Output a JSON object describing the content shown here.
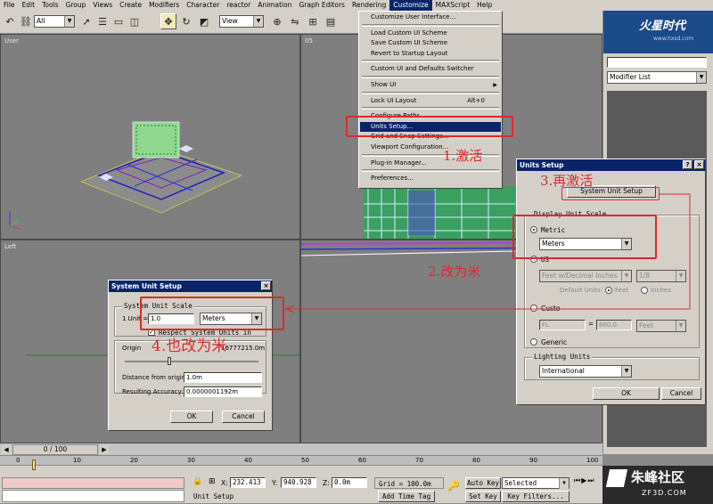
{
  "menubar": [
    "File",
    "Edit",
    "Tools",
    "Group",
    "Views",
    "Create",
    "Modifiers",
    "Character",
    "reactor",
    "Animation",
    "Graph Editors",
    "Rendering",
    "Customize",
    "MAXScript",
    "Help"
  ],
  "toolbar": {
    "selection_filter": "All",
    "coord_system": "View"
  },
  "watermark_top": "火星时代",
  "watermark_top_url": "www.hxsd.com",
  "viewports": {
    "top_left": "User",
    "top_right": "05",
    "bottom_left": "Left"
  },
  "customize_menu": {
    "items": [
      {
        "label": "Customize User Interface..."
      },
      {
        "sep": true
      },
      {
        "label": "Load Custom UI Scheme"
      },
      {
        "label": "Save Custom UI Scheme"
      },
      {
        "label": "Revert to Startup Layout"
      },
      {
        "sep": true
      },
      {
        "label": "Custom UI and Defaults Switcher"
      },
      {
        "sep": true
      },
      {
        "label": "Show UI",
        "submenu": true
      },
      {
        "sep": true
      },
      {
        "label": "Lock UI Layout",
        "shortcut": "Alt+0"
      },
      {
        "sep": true
      },
      {
        "label": "Configure Paths..."
      },
      {
        "label": "Units Setup...",
        "highlighted": true
      },
      {
        "label": "Grid and Snap Settings..."
      },
      {
        "label": "Viewport Configuration..."
      },
      {
        "sep": true
      },
      {
        "label": "Plug-in Manager..."
      },
      {
        "sep": true
      },
      {
        "label": "Preferences..."
      }
    ]
  },
  "command_panel": {
    "modifier_list": "Modifier List"
  },
  "units_dialog": {
    "title": "Units Setup",
    "system_unit_button": "System Unit Setup",
    "display_group": "Display Unit Scale",
    "metric_label": "Metric",
    "metric_value": "Meters",
    "us_label": "US",
    "us_value": "Feet w/Decimal Inches",
    "us_fraction": "1/8",
    "default_units": "Default Units:",
    "feet_label": "Feet",
    "inches_label": "Inches",
    "custom_label": "Custo",
    "custom_name": "FL",
    "custom_eq": "=",
    "custom_value": "660.0",
    "custom_unit": "Feet",
    "generic_label": "Generic",
    "lighting_group": "Lighting Units",
    "lighting_value": "International",
    "ok": "OK",
    "cancel": "Cancel"
  },
  "system_dialog": {
    "title": "System Unit Setup",
    "group": "System Unit Scale",
    "unit_label": "1 Unit =",
    "unit_value": "1.0",
    "unit_type": "Meters",
    "respect_label": "Respect System Units in",
    "origin_label": "Origin",
    "origin_value": "16777215.0m",
    "distance_label": "Distance from origin:",
    "distance_value": "1.0m",
    "accuracy_label": "Resulting Accuracy:",
    "accuracy_value": "0.0000001192m",
    "ok": "OK",
    "cancel": "Cancel"
  },
  "annotations": {
    "a1": "1.激活",
    "a2": "2.改为米",
    "a3": "3.再激活",
    "a4": "4.也改为米"
  },
  "timeline": {
    "frame": "0 / 100",
    "ticks": [
      "0",
      "10",
      "20",
      "30",
      "40",
      "50",
      "60",
      "70",
      "80",
      "90",
      "100"
    ]
  },
  "status": {
    "x_label": "X:",
    "x_val": "232.413",
    "y_label": "Y:",
    "y_val": "940.928",
    "z_label": "Z:",
    "z_val": "0.0m",
    "grid": "Grid = 100.0m",
    "auto_key": "Auto Key",
    "selected": "Selected",
    "set_key": "Set Key",
    "key_filters": "Key Filters...",
    "add_time_tag": "Add Time Tag",
    "prompt": "Unit Setup"
  },
  "watermark_bottom": "朱峰社区",
  "watermark_bottom_url": "ZF3D.COM"
}
